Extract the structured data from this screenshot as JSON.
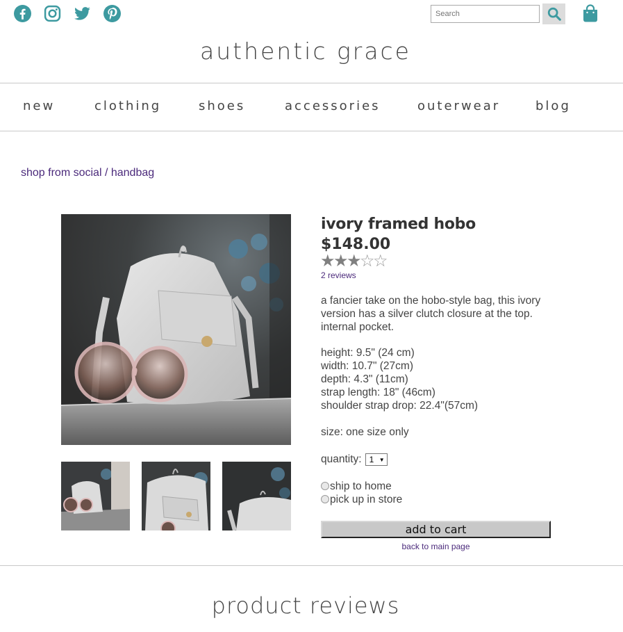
{
  "social": {
    "icons": [
      "facebook-icon",
      "instagram-icon",
      "twitter-icon",
      "pinterest-icon"
    ],
    "color": "#3d9aa0"
  },
  "search": {
    "placeholder": "Search",
    "value": ""
  },
  "site_title": "authentic grace",
  "nav": {
    "items": [
      "new",
      "clothing",
      "shoes",
      "accessories",
      "outerwear",
      "blog"
    ]
  },
  "breadcrumb": {
    "parent": "shop from social",
    "separator": "/",
    "current": "handbag"
  },
  "product": {
    "title": "ivory framed hobo",
    "price": "$148.00",
    "rating": 3,
    "rating_max": 5,
    "reviews_link": "2 reviews",
    "description": "a fancier take on the hobo-style bag, this ivory version has a silver clutch closure at the top. internal pocket.",
    "specs": [
      "height: 9.5\" (24 cm)",
      "width: 10.7\" (27cm)",
      "depth: 4.3\" (11cm)",
      "strap length: 18\" (46cm)",
      "shoulder strap drop: 22.4\"(57cm)"
    ],
    "size": "size: one size only",
    "quantity_label": "quantity:",
    "quantity_value": "1",
    "delivery_options": [
      "ship to home",
      "pick up in store"
    ],
    "add_to_cart": "add to cart",
    "back_link": "back to main page"
  },
  "reviews_section_title": "product reviews",
  "colors": {
    "accent": "#3d9aa0",
    "link": "#4b2a7b",
    "button": "#c8c8c8"
  }
}
